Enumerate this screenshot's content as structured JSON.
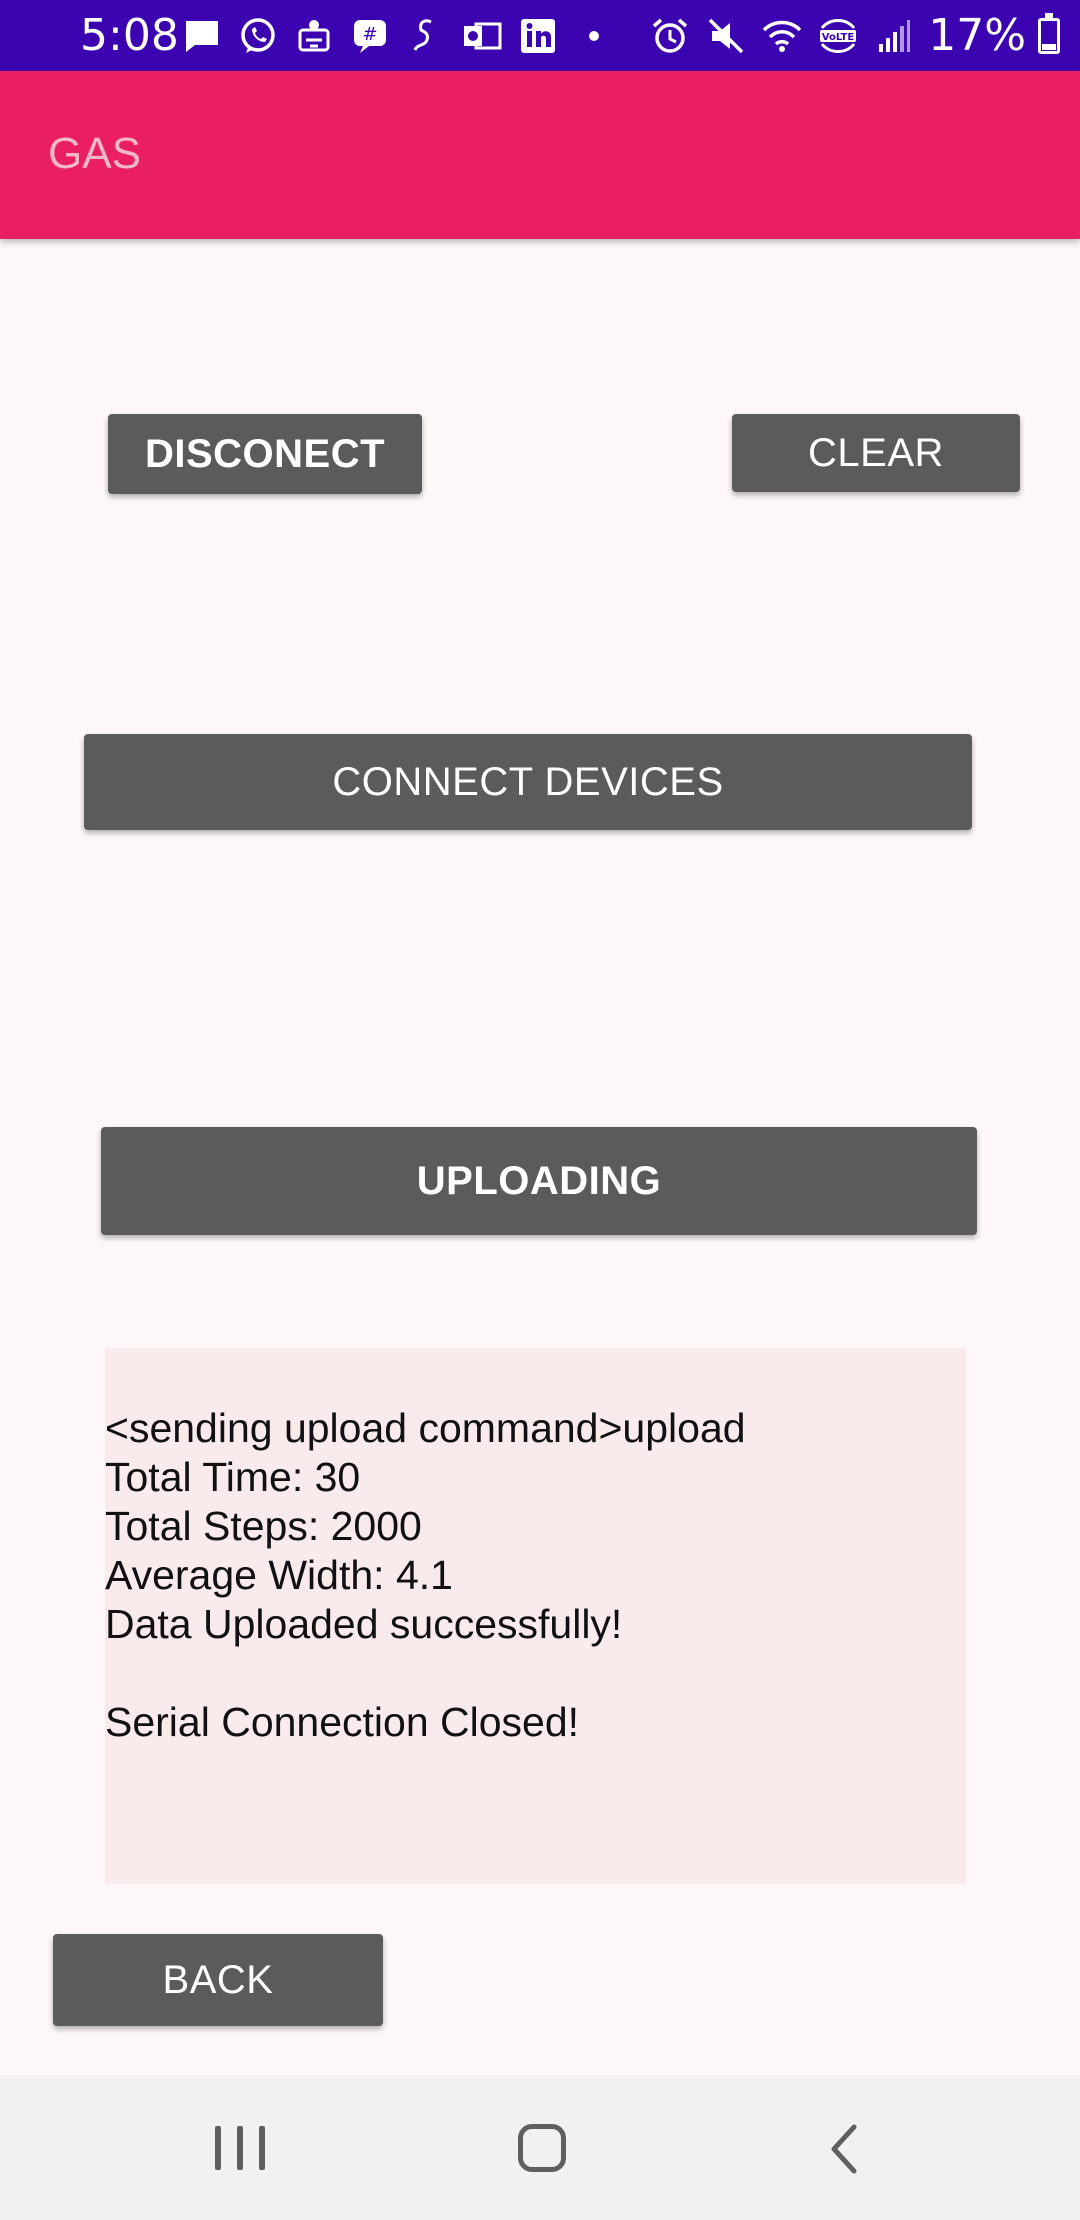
{
  "status_bar": {
    "time": "5:08",
    "battery_percent": "17%",
    "notification_icons": [
      "message-icon",
      "whatsapp-icon",
      "app-icon",
      "chat-icon",
      "snapchat-icon",
      "outlook-icon",
      "linkedin-icon",
      "dot-icon"
    ],
    "system_icons": [
      "alarm-icon",
      "mute-icon",
      "wifi-icon",
      "volte-icon",
      "signal-icon",
      "battery-icon"
    ],
    "background_color": "#3b04b0"
  },
  "app_bar": {
    "title": "GAS",
    "background_color": "#e91e63"
  },
  "buttons": {
    "disconnect_label": "DISCONECT",
    "clear_label": "CLEAR",
    "connect_devices_label": "CONNECT DEVICES",
    "uploading_label": "UPLOADING",
    "back_label": "BACK",
    "background_color": "#5b5b5c"
  },
  "log": {
    "lines": [
      "<sending upload command>upload",
      "Total Time: 30",
      "Total Steps: 2000",
      "Average Width: 4.1",
      "Data Uploaded successfully!",
      "",
      "Serial Connection Closed!"
    ]
  },
  "nav_bar": {
    "icons": [
      "recent-apps-icon",
      "home-icon",
      "back-icon"
    ]
  }
}
